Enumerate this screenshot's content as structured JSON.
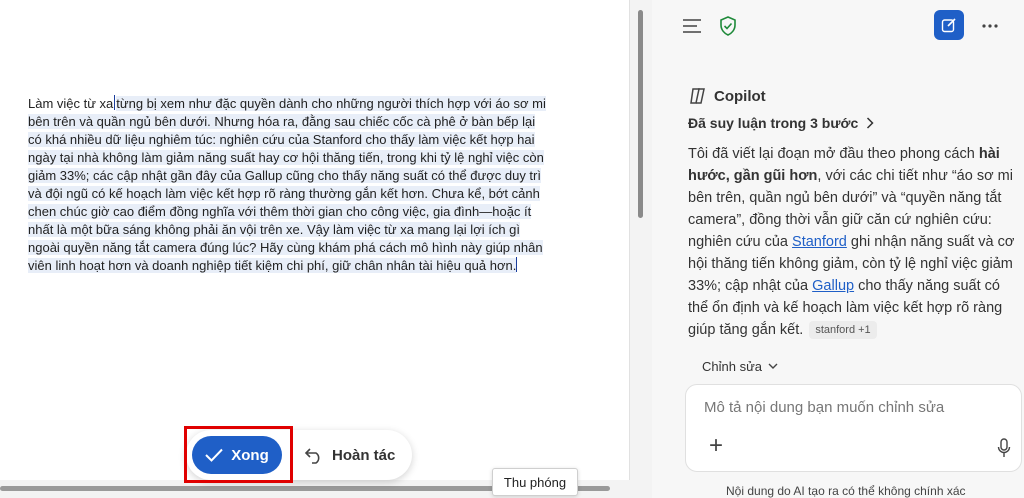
{
  "document": {
    "text_start": "Làm việc từ xa",
    "text_rest": "từng bị xem như đặc quyền dành cho những người thích hợp với áo sơ mi bên trên và quần ngủ bên dưới. Nhưng hóa ra, đằng sau chiếc cốc cà phê ở bàn bếp lại có khá nhiều dữ liệu nghiêm túc: nghiên cứu của Stanford cho thấy làm việc kết hợp hai ngày tại nhà không làm giảm năng suất hay cơ hội thăng tiến, trong khi tỷ lệ nghỉ việc còn giảm 33%; các cập nhật gần đây của Gallup cũng cho thấy năng suất có thể được duy trì và đội ngũ có kế hoạch làm việc kết hợp rõ ràng thường gắn kết hơn. Chưa kể, bớt cảnh chen chúc giờ cao điểm đồng nghĩa với thêm thời gian cho công việc, gia đình—hoặc ít nhất là một bữa sáng không phải ăn vội trên xe. Vậy làm việc từ xa mang lại lợi ích gì ngoài quyền năng tắt camera đúng lúc? Hãy cùng khám phá cách mô hình này giúp nhân viên linh hoạt hơn và doanh nghiệp tiết kiệm chi phí, giữ chân nhân tài hiệu quả hơn."
  },
  "action_bar": {
    "done_label": "Xong",
    "undo_label": "Hoàn tác"
  },
  "tooltip": {
    "zoom": "Thu phóng"
  },
  "copilot": {
    "title": "Copilot",
    "reasoning": "Đã suy luận trong 3 bước",
    "reply": {
      "p1": "Tôi đã viết lại đoạn mở đầu theo phong cách ",
      "p1_bold": "hài hước, gần gũi hơn",
      "p2": ", với các chi tiết như “áo sơ mi bên trên, quần ngủ bên dưới” và “quyền năng tắt camera”, đồng thời vẫn giữ căn cứ nghiên cứu: nghiên cứu của ",
      "link1": "Stanford",
      "p3": " ghi nhận năng suất và cơ hội thăng tiến không giảm, còn tỷ lệ nghỉ việc giảm 33%; cập nhật của ",
      "link2": "Gallup",
      "p4": " cho thấy năng suất có thể ổn định và kế hoạch làm việc kết hợp rõ ràng giúp tăng gắn kết.",
      "source_chip": "stanford +1"
    },
    "edit_dropdown": "Chỉnh sửa",
    "composer_placeholder": "Mô tả nội dung bạn muốn chỉnh sửa",
    "disclaimer": "Nội dung do AI tạo ra có thể không chính xác"
  },
  "icons": {
    "menu": "menu-icon",
    "shield": "shield-check-icon",
    "new_chat": "compose-icon",
    "more": "more-icon",
    "copilot": "copilot-logo-icon",
    "chevron_right": "chevron-right-icon",
    "chevron_down": "chevron-down-icon",
    "check": "check-icon",
    "undo": "undo-icon",
    "plus": "plus-icon",
    "mic": "microphone-icon"
  },
  "colors": {
    "accent": "#1f5fc7",
    "highlight_box": "#e00000",
    "shield_green": "#1f8a3a"
  }
}
